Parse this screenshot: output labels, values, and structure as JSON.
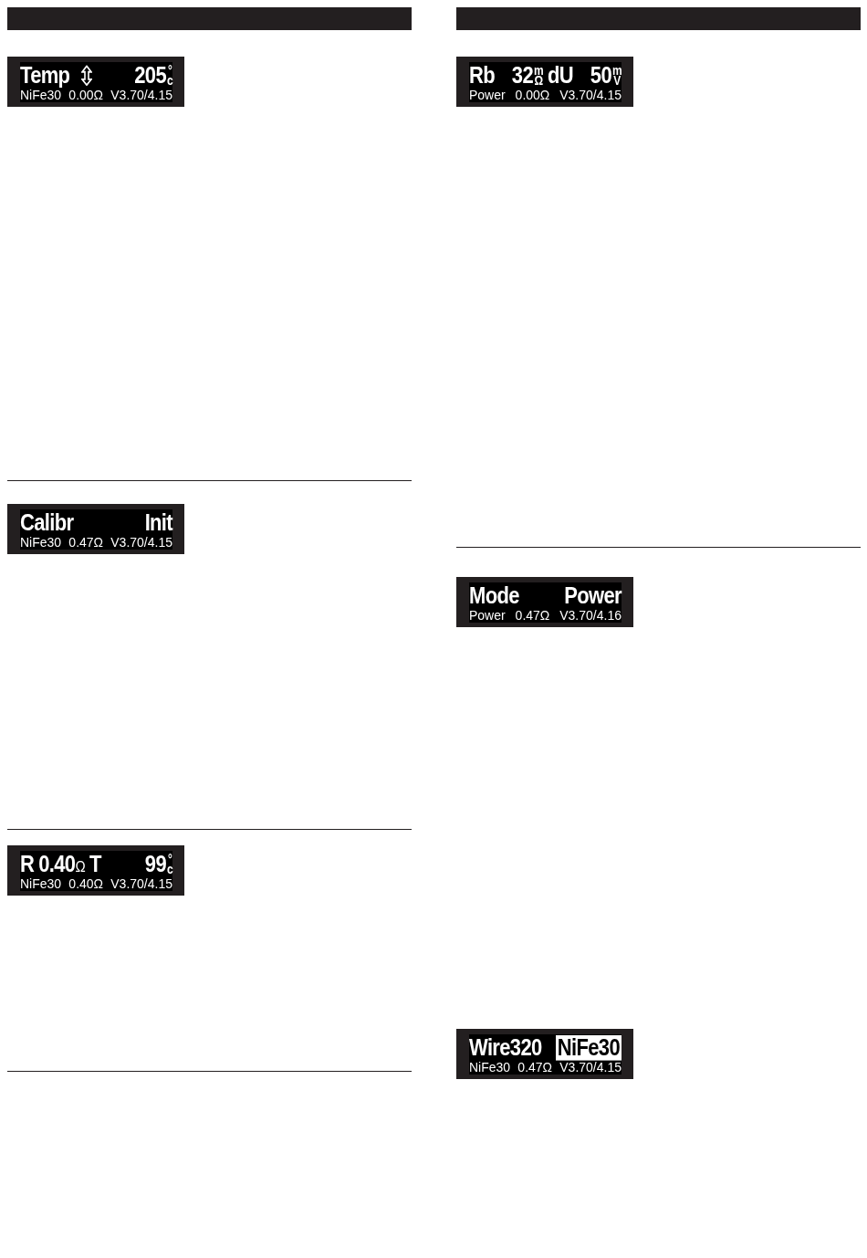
{
  "columns": [
    {
      "sections": [
        {
          "rule_after": true,
          "displays": [
            {
              "adjustable": true,
              "line1": [
                [
                  {
                    "text": "Temp",
                    "selected": false
                  }
                ],
                [
                  {
                    "text": "205",
                    "unit_top": "°",
                    "unit_bottom": "c",
                    "selected": false
                  }
                ]
              ],
              "line2": [
                "NiFe30",
                "0.00Ω",
                "V3.70/4.15"
              ]
            }
          ]
        },
        {
          "rule_after": true,
          "displays": [
            {
              "adjustable": false,
              "line1": [
                [
                  {
                    "text": "Calibr",
                    "selected": false
                  }
                ],
                [
                  {
                    "text": "Init",
                    "selected": false
                  }
                ]
              ],
              "line2": [
                "NiFe30",
                "0.47Ω",
                "V3.70/4.15"
              ]
            }
          ]
        },
        {
          "rule_after": true,
          "displays": [
            {
              "adjustable": false,
              "line1": [
                [
                  {
                    "text": "R",
                    "selected": false
                  },
                  {
                    "text": "0.40",
                    "unit": "Ω",
                    "selected": false
                  },
                  {
                    "text": "T",
                    "selected": false
                  }
                ],
                [
                  {
                    "text": "99",
                    "unit_top": "°",
                    "unit_bottom": "c",
                    "selected": false
                  }
                ]
              ],
              "line2": [
                "NiFe30",
                "0.40Ω",
                "V3.70/4.15"
              ]
            }
          ]
        }
      ]
    },
    {
      "sections": [
        {
          "rule_after": true,
          "displays": [
            {
              "adjustable": false,
              "line1": [
                [
                  {
                    "text": "Rb",
                    "selected": false
                  }
                ],
                [
                  {
                    "text": "32",
                    "unit_top": "m",
                    "unit_bottom": "Ω",
                    "selected": false
                  },
                  {
                    "text": "dU",
                    "selected": false
                  }
                ],
                [
                  {
                    "text": "50",
                    "unit_top": "m",
                    "unit_bottom": "V",
                    "selected": false
                  }
                ]
              ],
              "line2": [
                "Power",
                "0.00Ω",
                "V3.70/4.15"
              ]
            }
          ]
        },
        {
          "rule_after": false,
          "displays": [
            {
              "adjustable": false,
              "line1": [
                [
                  {
                    "text": "Mode",
                    "selected": false
                  }
                ],
                [
                  {
                    "text": "Power",
                    "selected": false
                  }
                ]
              ],
              "line2": [
                "Power",
                "0.47Ω",
                "V3.70/4.16"
              ]
            },
            {
              "adjustable": false,
              "line1": [
                [
                  {
                    "text": "Wire320",
                    "selected": false
                  }
                ],
                [
                  {
                    "text": "NiFe30",
                    "selected": true
                  }
                ]
              ],
              "line2": [
                "NiFe30",
                "0.47Ω",
                "V3.70/4.15"
              ]
            }
          ]
        }
      ]
    }
  ]
}
